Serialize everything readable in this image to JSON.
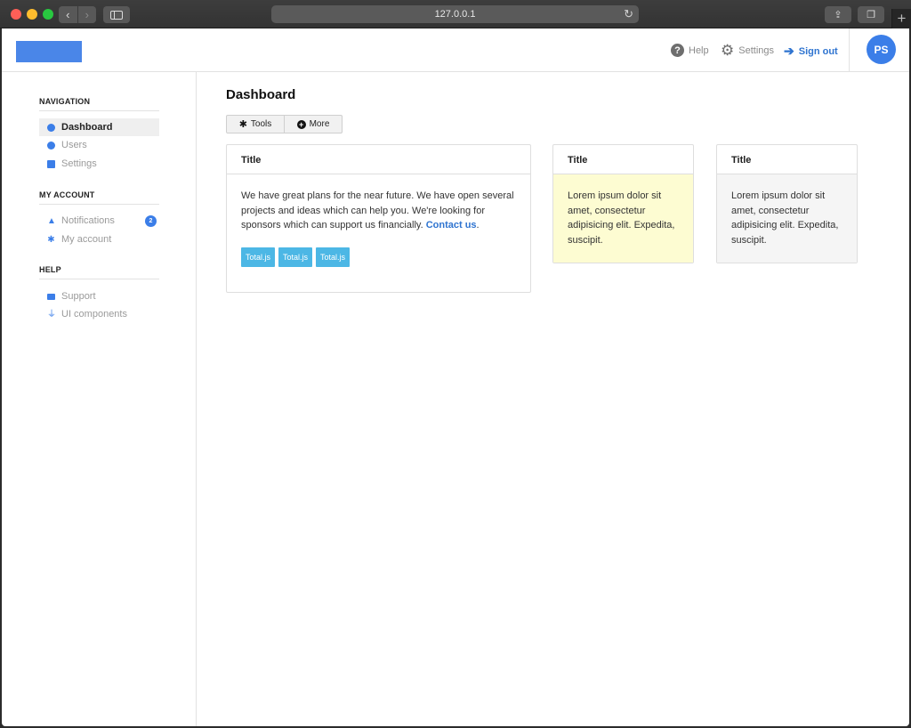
{
  "browser": {
    "url": "127.0.0.1"
  },
  "header": {
    "help_label": "Help",
    "settings_label": "Settings",
    "signout_label": "Sign out",
    "avatar_initials": "PS"
  },
  "sidebar": {
    "sections": [
      {
        "title": "NAVIGATION",
        "items": [
          {
            "label": "Dashboard",
            "icon": "dashboard-icon",
            "active": true
          },
          {
            "label": "Users",
            "icon": "clock-icon"
          },
          {
            "label": "Settings",
            "icon": "box-icon"
          }
        ]
      },
      {
        "title": "MY ACCOUNT",
        "items": [
          {
            "label": "Notifications",
            "icon": "bell-icon",
            "badge": "2"
          },
          {
            "label": "My account",
            "icon": "gear-icon"
          }
        ]
      },
      {
        "title": "HELP",
        "items": [
          {
            "label": "Support",
            "icon": "credit-card-icon"
          },
          {
            "label": "UI components",
            "icon": "plug-icon"
          }
        ]
      }
    ]
  },
  "main": {
    "title": "Dashboard",
    "toolbar": {
      "tools_label": "Tools",
      "more_label": "More"
    },
    "cards": [
      {
        "title": "Title",
        "text": "We have great plans for the near future. We have open several projects and ideas which can help you. We're looking for sponsors which can support us financially.",
        "link": "Contact us",
        "tags": [
          "Total.js",
          "Total.js",
          "Total.js"
        ]
      },
      {
        "title": "Title",
        "text": "Lorem ipsum dolor sit amet, consectetur adipisicing elit. Expedita, suscipit."
      },
      {
        "title": "Title",
        "text": "Lorem ipsum dolor sit amet, consectetur adipisicing elit. Expedita, suscipit."
      }
    ]
  },
  "colors": {
    "accent": "#3b7ee8",
    "tag": "#4cb7e5",
    "yellow_card": "#fdfcd2",
    "grey_card": "#f5f5f5"
  }
}
